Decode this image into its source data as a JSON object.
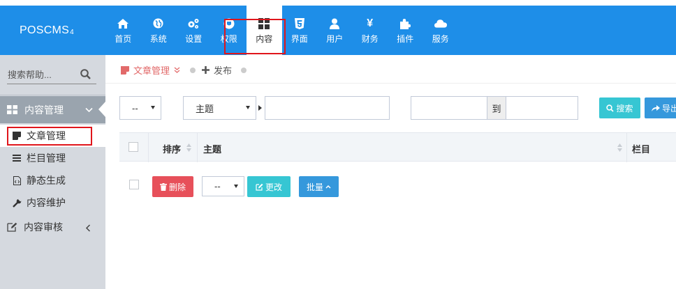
{
  "app": {
    "logo": "POSCMS",
    "logo_version": "4"
  },
  "topnav": [
    {
      "label": "首页",
      "icon": "home-icon"
    },
    {
      "label": "系统",
      "icon": "globe-icon"
    },
    {
      "label": "设置",
      "icon": "cogs-icon"
    },
    {
      "label": "权限",
      "icon": "shield-icon"
    },
    {
      "label": "内容",
      "icon": "grid-icon",
      "active": true
    },
    {
      "label": "界面",
      "icon": "html5-icon"
    },
    {
      "label": "用户",
      "icon": "user-icon"
    },
    {
      "label": "财务",
      "icon": "yen-icon"
    },
    {
      "label": "插件",
      "icon": "puzzle-icon"
    },
    {
      "label": "服务",
      "icon": "cloud-icon"
    }
  ],
  "sidebar": {
    "search_placeholder": "搜索帮助...",
    "group": {
      "label": "内容管理",
      "icon": "grid-icon"
    },
    "items": [
      {
        "label": "文章管理",
        "icon": "edit-doc-icon",
        "active": true
      },
      {
        "label": "栏目管理",
        "icon": "list-icon"
      },
      {
        "label": "静态生成",
        "icon": "html-file-icon"
      },
      {
        "label": "内容维护",
        "icon": "wrench-icon"
      }
    ],
    "group2": {
      "label": "内容审核",
      "icon": "edit-icon"
    }
  },
  "breadcrumb": {
    "current": "文章管理",
    "link": "发布"
  },
  "filters": {
    "select1": "--",
    "field_select": "主题",
    "keyword": "",
    "date_from": "",
    "date_to_label": "到",
    "date_to": "",
    "search_label": "搜索",
    "export_label": "导出"
  },
  "table": {
    "headers": {
      "order": "排序",
      "title": "主题",
      "category": "栏目"
    }
  },
  "bulk": {
    "delete_label": "删除",
    "select": "--",
    "change_label": "更改",
    "batch_label": "批量"
  },
  "colors": {
    "topbar": "#1e8ee8",
    "sidebar": "#d5d9df",
    "sidebar_active_group": "#9aa4ae",
    "highlight_box": "#e0151b",
    "search_button": "#36c6d3",
    "export_button": "#3598dc",
    "delete_button": "#e7505a",
    "change_button": "#36c6d3",
    "batch_button": "#3598dc",
    "breadcrumb_active": "#e26a6a"
  }
}
